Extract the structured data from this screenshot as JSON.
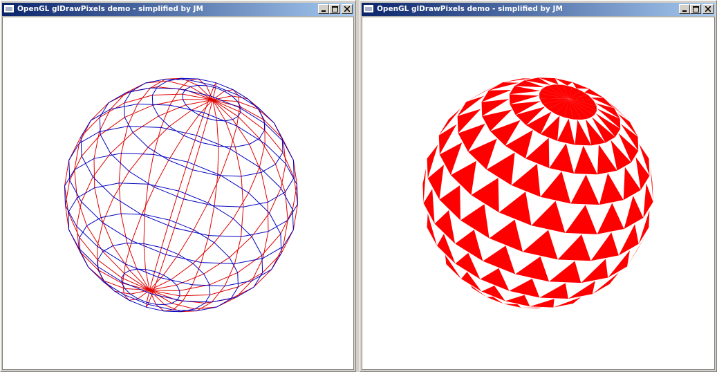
{
  "windows": [
    {
      "title": "OpenGL glDrawPixels demo - simplified by JM",
      "render_mode": "wireframe",
      "colors": {
        "longitude": "#e00000",
        "latitude": "#0000c0"
      }
    },
    {
      "title": "OpenGL glDrawPixels demo - simplified by JM",
      "render_mode": "checkered",
      "colors": {
        "fill": "#ff0000",
        "background": "#ffffff"
      }
    }
  ],
  "icons": {
    "app": "window-icon",
    "minimize": "minimize-icon",
    "maximize": "maximize-icon",
    "close": "close-icon"
  }
}
